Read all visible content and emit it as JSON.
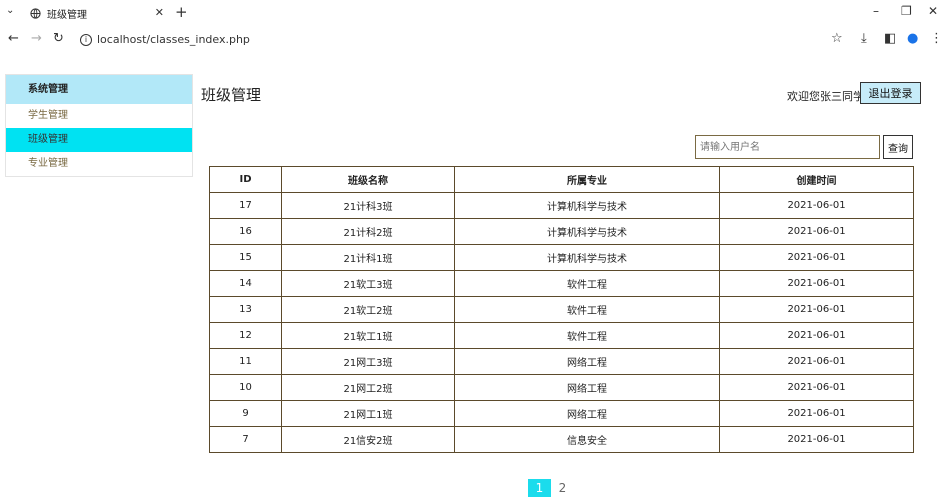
{
  "browser": {
    "tab_title": "班级管理",
    "url": "localhost/classes_index.php"
  },
  "sidebar": {
    "header": "系统管理",
    "items": [
      {
        "label": "学生管理",
        "active": false
      },
      {
        "label": "班级管理",
        "active": true
      },
      {
        "label": "专业管理",
        "active": false
      }
    ]
  },
  "header": {
    "title": "班级管理",
    "welcome": "欢迎您张三同学",
    "logout_label": "退出登录"
  },
  "search": {
    "placeholder": "请输入用户名",
    "button_label": "查询"
  },
  "table": {
    "columns": [
      "ID",
      "班级名称",
      "所属专业",
      "创建时间"
    ],
    "rows": [
      [
        "17",
        "21计科3班",
        "计算机科学与技术",
        "2021-06-01"
      ],
      [
        "16",
        "21计科2班",
        "计算机科学与技术",
        "2021-06-01"
      ],
      [
        "15",
        "21计科1班",
        "计算机科学与技术",
        "2021-06-01"
      ],
      [
        "14",
        "21软工3班",
        "软件工程",
        "2021-06-01"
      ],
      [
        "13",
        "21软工2班",
        "软件工程",
        "2021-06-01"
      ],
      [
        "12",
        "21软工1班",
        "软件工程",
        "2021-06-01"
      ],
      [
        "11",
        "21网工3班",
        "网络工程",
        "2021-06-01"
      ],
      [
        "10",
        "21网工2班",
        "网络工程",
        "2021-06-01"
      ],
      [
        "9",
        "21网工1班",
        "网络工程",
        "2021-06-01"
      ],
      [
        "7",
        "21信安2班",
        "信息安全",
        "2021-06-01"
      ]
    ]
  },
  "pagination": {
    "pages": [
      "1",
      "2"
    ],
    "current": "1"
  },
  "colors": {
    "sidebar_header": "#b2e8f8",
    "sidebar_active": "#00e2f2",
    "pager_active": "#1bdcec"
  }
}
